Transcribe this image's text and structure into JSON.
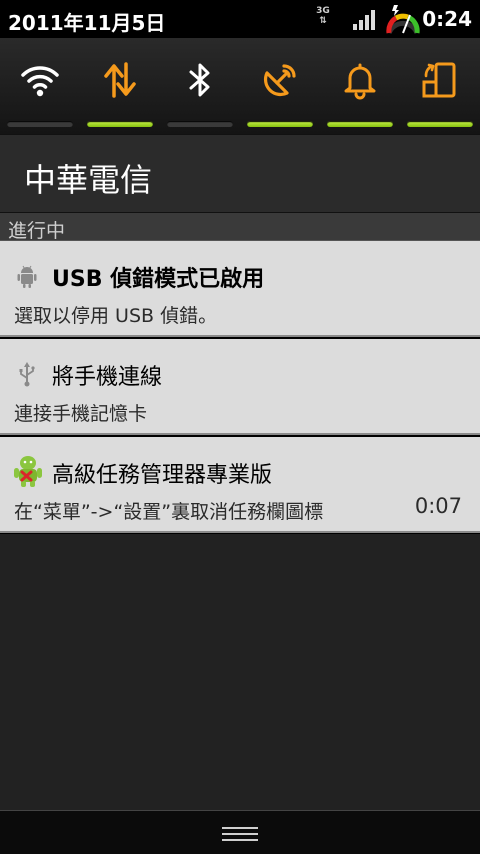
{
  "status_bar": {
    "date": "2011年11月5日",
    "network_type": "3G",
    "time": "0:24",
    "icons": [
      "3g-data-icon",
      "signal-strength-icon",
      "battery-charging-icon"
    ]
  },
  "quick_settings": [
    {
      "name": "wifi",
      "icon": "wifi-icon",
      "enabled": false,
      "color": "#ffffff"
    },
    {
      "name": "data-sync",
      "icon": "sync-arrows-icon",
      "enabled": true,
      "color": "#f59a1c"
    },
    {
      "name": "bluetooth",
      "icon": "bluetooth-icon",
      "enabled": false,
      "color": "#ffffff"
    },
    {
      "name": "gps",
      "icon": "satellite-dish-icon",
      "enabled": true,
      "color": "#f59a1c"
    },
    {
      "name": "sound",
      "icon": "bell-icon",
      "enabled": true,
      "color": "#f59a1c"
    },
    {
      "name": "auto-rotate",
      "icon": "rotate-phone-icon",
      "enabled": true,
      "color": "#f59a1c"
    }
  ],
  "carrier": "中華電信",
  "section_ongoing": "進行中",
  "notifications": [
    {
      "title": "USB 偵錯模式已啟用",
      "subtitle": "選取以停用 USB 偵錯。",
      "time": "",
      "icon": "android-robot-icon"
    },
    {
      "title": "將手機連線",
      "subtitle": "連接手機記憶卡",
      "time": "",
      "icon": "usb-icon"
    },
    {
      "title": "高級任務管理器專業版",
      "subtitle": "在“菜單”->“設置”裏取消任務欄圖標",
      "time": "0:07",
      "icon": "task-manager-icon"
    }
  ],
  "colors": {
    "accent_orange": "#f59a1c",
    "toggle_on": "#9ad11a",
    "notification_bg": "#dcdcdc"
  }
}
